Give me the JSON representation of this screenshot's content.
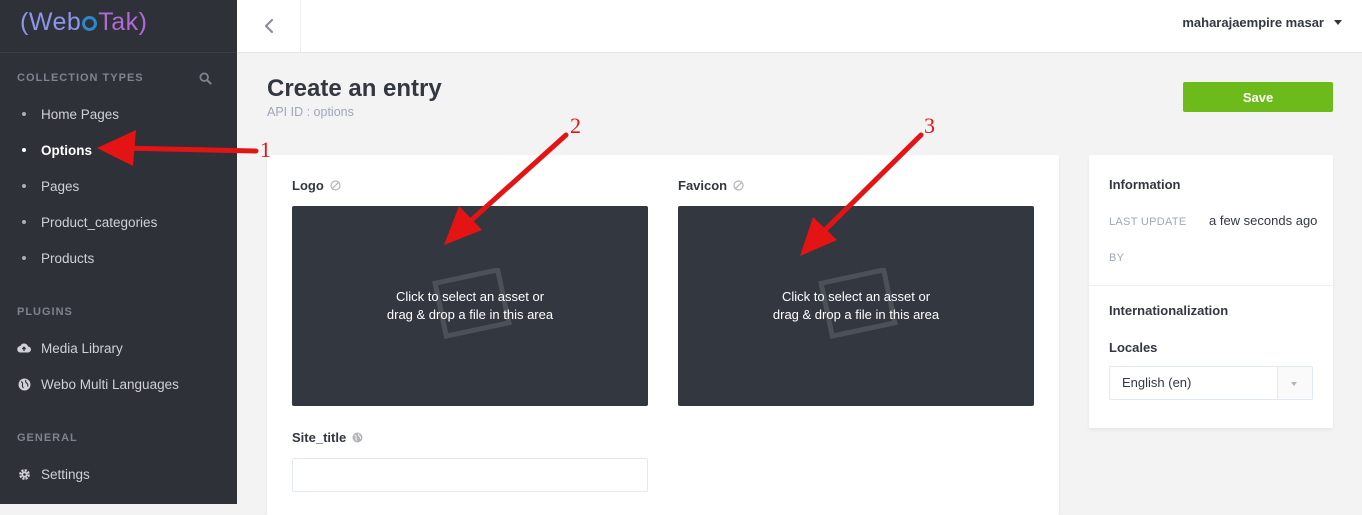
{
  "brand": {
    "part1": "(Web",
    "part2": "Tak)"
  },
  "sidebar": {
    "collection_types": {
      "title": "COLLECTION TYPES",
      "items": [
        {
          "label": "Home Pages",
          "active": false
        },
        {
          "label": "Options",
          "active": true
        },
        {
          "label": "Pages",
          "active": false
        },
        {
          "label": "Product_categories",
          "active": false
        },
        {
          "label": "Products",
          "active": false
        }
      ]
    },
    "plugins": {
      "title": "PLUGINS",
      "items": [
        {
          "label": "Media Library",
          "icon": "cloud-upload-icon"
        },
        {
          "label": "Webo Multi Languages",
          "icon": "globe-icon"
        }
      ]
    },
    "general": {
      "title": "GENERAL",
      "items": [
        {
          "label": "Settings",
          "icon": "gear-icon"
        }
      ]
    }
  },
  "header": {
    "user_name": "maharajaempire masar"
  },
  "page": {
    "title": "Create an entry",
    "api_id": "API ID : options",
    "save_label": "Save"
  },
  "fields": {
    "logo": {
      "label": "Logo",
      "dropzone_line1": "Click to select an asset or",
      "dropzone_line2": "drag & drop a file in this area"
    },
    "favicon": {
      "label": "Favicon",
      "dropzone_line1": "Click to select an asset or",
      "dropzone_line2": "drag & drop a file in this area"
    },
    "site_title": {
      "label": "Site_title",
      "value": ""
    }
  },
  "info_panel": {
    "title": "Information",
    "last_update_key": "LAST UPDATE",
    "last_update_value": "a few seconds ago",
    "by_key": "BY",
    "by_value": ""
  },
  "i18n_panel": {
    "title": "Internationalization",
    "locales_label": "Locales",
    "selected_locale": "English (en)"
  },
  "annotations": [
    "1",
    "2",
    "3"
  ],
  "colors": {
    "sidebar_bg": "#2e3138",
    "save_green": "#6dbb1a",
    "dropzone_bg": "#333740",
    "annotation_red": "#e41414"
  }
}
